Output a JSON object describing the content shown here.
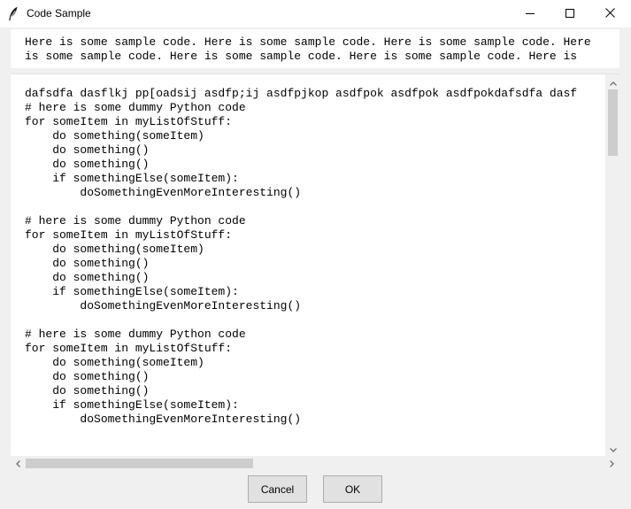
{
  "window": {
    "title": "Code Sample"
  },
  "header": {
    "lines": [
      "Here is some sample code. Here is some sample code. Here is some sample code. Here",
      "is some sample code. Here is some sample code. Here is some sample code. Here is"
    ]
  },
  "code": {
    "text": "dafsdfa dasflkj pp[oadsij asdfp;ij asdfpjkop asdfpok asdfpok asdfpokdafsdfa dasf\n# here is some dummy Python code\nfor someItem in myListOfStuff:\n    do something(someItem)\n    do something()\n    do something()\n    if somethingElse(someItem):\n        doSomethingEvenMoreInteresting()\n\n# here is some dummy Python code\nfor someItem in myListOfStuff:\n    do something(someItem)\n    do something()\n    do something()\n    if somethingElse(someItem):\n        doSomethingEvenMoreInteresting()\n\n# here is some dummy Python code\nfor someItem in myListOfStuff:\n    do something(someItem)\n    do something()\n    do something()\n    if somethingElse(someItem):\n        doSomethingEvenMoreInteresting()"
  },
  "buttons": {
    "cancel": "Cancel",
    "ok": "OK"
  },
  "icons": {
    "app": "feather-icon",
    "minimize": "minimize-icon",
    "maximize": "maximize-icon",
    "close": "close-icon"
  }
}
